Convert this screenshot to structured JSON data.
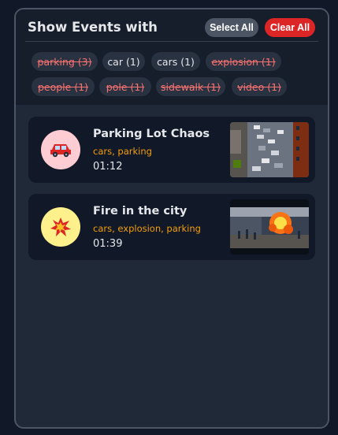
{
  "panel": {
    "title": "Show Events with",
    "select_all_label": "Select All",
    "clear_all_label": "Clear All"
  },
  "filters": [
    {
      "label": "parking (3)",
      "active": false
    },
    {
      "label": "car (1)",
      "active": true
    },
    {
      "label": "cars (1)",
      "active": true
    },
    {
      "label": "explosion (1)",
      "active": false
    },
    {
      "label": "people (1)",
      "active": false
    },
    {
      "label": "pole (1)",
      "active": false
    },
    {
      "label": "sidewalk (1)",
      "active": false
    },
    {
      "label": "video (1)",
      "active": false
    }
  ],
  "events": [
    {
      "title": "Parking Lot Chaos",
      "tags": "cars, parking",
      "time": "01:12",
      "icon": "car-icon",
      "icon_bg": "#fecdd3",
      "thumbnail": "parking-lot-thumbnail"
    },
    {
      "title": "Fire in the city",
      "tags": "cars, explosion, parking",
      "time": "01:39",
      "icon": "explosion-icon",
      "icon_bg": "#fef08a",
      "thumbnail": "street-fire-thumbnail"
    }
  ],
  "colors": {
    "background": "#111827",
    "panel": "#1f2937",
    "accent_danger": "#dc2626",
    "inactive_chip_text": "#f87171",
    "tag_text": "#f59e0b"
  }
}
